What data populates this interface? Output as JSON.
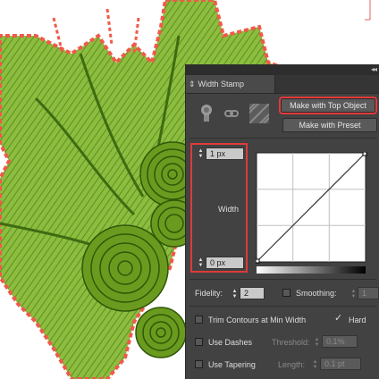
{
  "panel": {
    "tab_title": "Width Stamp",
    "tab_chevron": "⇕",
    "close_glyph": "✕",
    "collapse_glyph": "◂◂",
    "make_top_label": "Make with Top Object",
    "make_preset_label": "Make with Preset",
    "stamp_icons": [
      "hand-stamp-icon",
      "link-icon",
      "hatch-pattern-icon"
    ],
    "width_top_value": "1 px",
    "width_bottom_value": "0 px",
    "width_label": "Width",
    "fidelity_label": "Fidelity:",
    "fidelity_value": "2",
    "smoothing_label": "Smoothing:",
    "smoothing_value": "1",
    "smoothing_checked": false,
    "trim_label": "Trim Contours at Min Width",
    "trim_checked": false,
    "hard_label": "Hard",
    "hard_checked": true,
    "dashes_label": "Use Dashes",
    "dashes_checked": false,
    "threshold_label": "Threshold:",
    "threshold_value": "0.1%",
    "tapering_label": "Use Tapering",
    "tapering_checked": false,
    "length_label": "Length:",
    "length_value": "0.1 pt",
    "curve": {
      "type": "linear",
      "from": [
        0,
        0
      ],
      "to": [
        1,
        1
      ]
    }
  },
  "colors": {
    "panel_bg": "#424242",
    "highlight": "#e03a3a",
    "leaf_green": "#7fb03a",
    "leaf_dark": "#3f6b12",
    "edge_red": "#ef5a4a"
  }
}
